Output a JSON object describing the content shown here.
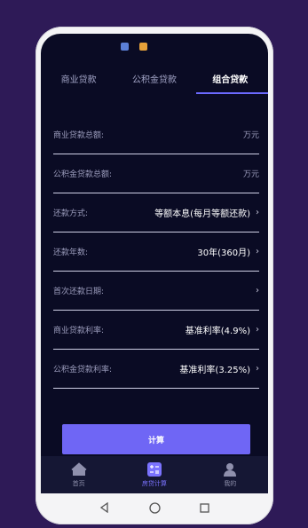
{
  "colors": {
    "background": "#2e1a57",
    "screen": "#0a0b24",
    "accent": "#6f66f5"
  },
  "tabs": [
    {
      "label": "商业贷款",
      "active": false
    },
    {
      "label": "公积金贷款",
      "active": false
    },
    {
      "label": "组合贷款",
      "active": true
    }
  ],
  "form": {
    "commercial_total": {
      "label": "商业贷款总额:",
      "unit": "万元"
    },
    "fund_total": {
      "label": "公积金贷款总额:",
      "unit": "万元"
    },
    "repay_method": {
      "label": "还款方式:",
      "value": "等额本息(每月等额还款)"
    },
    "years": {
      "label": "还款年数:",
      "value": "30年(360月)"
    },
    "first_date": {
      "label": "首次还款日期:",
      "value": ""
    },
    "commercial_rate": {
      "label": "商业贷款利率:",
      "value": "基准利率(4.9%)"
    },
    "fund_rate": {
      "label": "公积金贷款利率:",
      "value": "基准利率(3.25%)"
    }
  },
  "calc_button": "计算",
  "bottom_nav": [
    {
      "label": "首页",
      "icon": "home-icon",
      "active": false
    },
    {
      "label": "房贷计算",
      "icon": "calculator-icon",
      "active": true
    },
    {
      "label": "我的",
      "icon": "user-icon",
      "active": false
    }
  ],
  "system_nav": [
    "back-icon",
    "home-circle-icon",
    "recents-icon"
  ]
}
